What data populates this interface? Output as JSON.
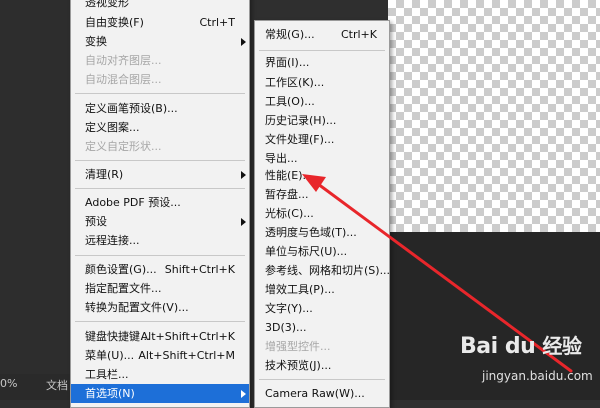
{
  "colors": {
    "highlight": "#1d6fd8",
    "annotation_arrow": "#e8262b",
    "workspace": "#2f2f2f"
  },
  "status_bar": {
    "zoom": "0%",
    "doc": "文档"
  },
  "edit_menu": {
    "items": [
      {
        "label": "透视变形"
      },
      {
        "label": "自由变换(F)",
        "shortcut": "Ctrl+T"
      },
      {
        "label": "变换"
      },
      {
        "label": "自动对齐图层..."
      },
      {
        "label": "自动混合图层..."
      },
      {
        "label": "定义画笔预设(B)..."
      },
      {
        "label": "定义图案..."
      },
      {
        "label": "定义自定形状..."
      },
      {
        "label": "清理(R)"
      },
      {
        "label": "Adobe PDF 预设..."
      },
      {
        "label": "预设"
      },
      {
        "label": "远程连接..."
      },
      {
        "label": "颜色设置(G)...",
        "shortcut": "Shift+Ctrl+K"
      },
      {
        "label": "指定配置文件..."
      },
      {
        "label": "转换为配置文件(V)..."
      },
      {
        "label": "键盘快捷键...",
        "shortcut": "Alt+Shift+Ctrl+K"
      },
      {
        "label": "菜单(U)...",
        "shortcut": "Alt+Shift+Ctrl+M"
      },
      {
        "label": "工具栏..."
      },
      {
        "label": "首选项(N)"
      }
    ]
  },
  "preferences_submenu": {
    "items": [
      {
        "label": "常规(G)...",
        "shortcut": "Ctrl+K"
      },
      {
        "label": "界面(I)..."
      },
      {
        "label": "工作区(K)..."
      },
      {
        "label": "工具(O)..."
      },
      {
        "label": "历史记录(H)..."
      },
      {
        "label": "文件处理(F)..."
      },
      {
        "label": "导出..."
      },
      {
        "label": "性能(E)..."
      },
      {
        "label": "暂存盘..."
      },
      {
        "label": "光标(C)..."
      },
      {
        "label": "透明度与色域(T)..."
      },
      {
        "label": "单位与标尺(U)..."
      },
      {
        "label": "参考线、网格和切片(S)..."
      },
      {
        "label": "增效工具(P)..."
      },
      {
        "label": "文字(Y)..."
      },
      {
        "label": "3D(3)..."
      },
      {
        "label": "增强型控件..."
      },
      {
        "label": "技术预览(J)..."
      },
      {
        "label": "Camera Raw(W)..."
      }
    ]
  },
  "watermark": {
    "logo": "Bai du",
    "brand": "经验",
    "url": "jingyan.baidu.com"
  }
}
